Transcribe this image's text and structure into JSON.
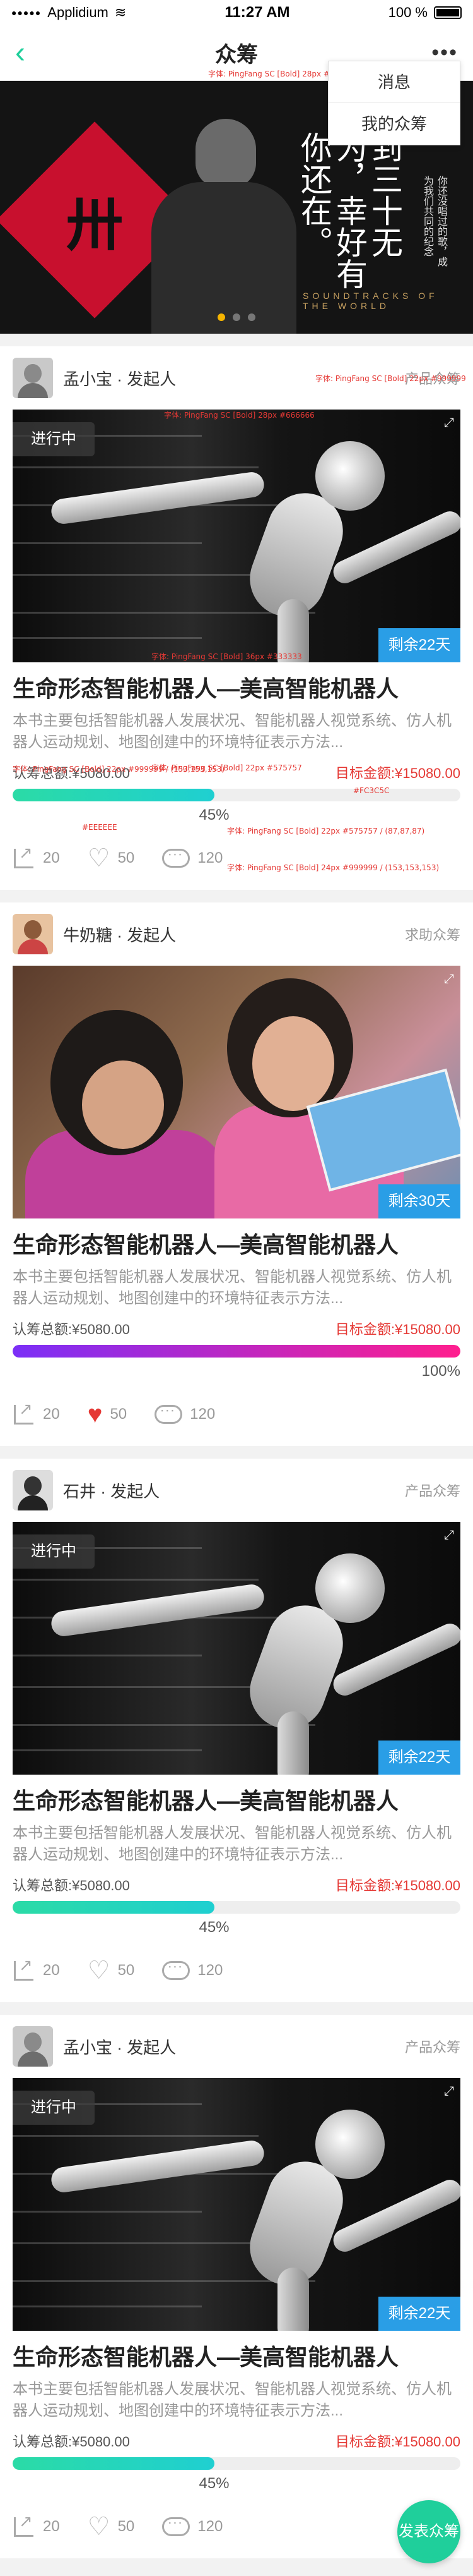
{
  "status_bar": {
    "carrier": "Applidium",
    "time": "11:27 AM",
    "battery": "100 %"
  },
  "nav": {
    "back_icon": "chevron-left-icon",
    "title": "众筹",
    "more_icon": "more-icon"
  },
  "dropdown": {
    "items": [
      "消息",
      "我的众筹"
    ]
  },
  "banner": {
    "slogan": "到三十无为，幸好有你还在。",
    "small_text": "你还没唱过的歌，成为我们共同的纪念",
    "caption": "SOUNDTRACKS OF THE WORLD",
    "pages": 3,
    "active_page": 0
  },
  "colors": {
    "accent": "#1fcf9b",
    "target_red": "#e53935",
    "days_blue": "#2a9ee6"
  },
  "cards": [
    {
      "user": "孟小宝 · 发起人",
      "category": "产品众筹",
      "cover": "robot",
      "progress_tag": "进行中",
      "days_left": "剩余22天",
      "title": "生命形态智能机器人—美高智能机器人",
      "desc": "本书主要包括智能机器人发展状况、智能机器人视觉系统、仿人机器人运动规划、地图创建中的环境特征表示方法...",
      "raised": "认筹总额:¥5080.00",
      "target": "目标金额:¥15080.00",
      "percent": 45,
      "percent_label": "45%",
      "bar": "teal",
      "shares": "20",
      "likes": "50",
      "liked": false,
      "comments": "120"
    },
    {
      "user": "牛奶糖 · 发起人",
      "category": "求助众筹",
      "cover": "kids",
      "progress_tag": "",
      "days_left": "剩余30天",
      "title": "生命形态智能机器人—美高智能机器人",
      "desc": "本书主要包括智能机器人发展状况、智能机器人视觉系统、仿人机器人运动规划、地图创建中的环境特征表示方法...",
      "raised": "认筹总额:¥5080.00",
      "target": "目标金额:¥15080.00",
      "percent": 100,
      "percent_label": "100%",
      "bar": "pink",
      "shares": "20",
      "likes": "50",
      "liked": true,
      "comments": "120"
    },
    {
      "user": "石井 · 发起人",
      "category": "产品众筹",
      "cover": "robot",
      "progress_tag": "进行中",
      "days_left": "剩余22天",
      "title": "生命形态智能机器人—美高智能机器人",
      "desc": "本书主要包括智能机器人发展状况、智能机器人视觉系统、仿人机器人运动规划、地图创建中的环境特征表示方法...",
      "raised": "认筹总额:¥5080.00",
      "target": "目标金额:¥15080.00",
      "percent": 45,
      "percent_label": "45%",
      "bar": "teal",
      "shares": "20",
      "likes": "50",
      "liked": false,
      "comments": "120"
    },
    {
      "user": "孟小宝 · 发起人",
      "category": "产品众筹",
      "cover": "robot",
      "progress_tag": "进行中",
      "days_left": "剩余22天",
      "title": "生命形态智能机器人—美高智能机器人",
      "desc": "本书主要包括智能机器人发展状况、智能机器人视觉系统、仿人机器人运动规划、地图创建中的环境特征表示方法...",
      "raised": "认筹总额:¥5080.00",
      "target": "目标金额:¥15080.00",
      "percent": 45,
      "percent_label": "45%",
      "bar": "teal",
      "shares": "20",
      "likes": "50",
      "liked": false,
      "comments": "120"
    }
  ],
  "fab": {
    "label": "发表众筹"
  },
  "annotations": [
    "字体: PingFang SC [Bold] 28px #666666",
    "字体: PingFang SC [Bold] 28px #666666",
    "字体: PingFang SC [Bold] 22px #999999",
    "字体: PingFang SC [Bold] 36px #333333",
    "字体: PingFang SC [Bold] 22px #999999 / (153,153,153)",
    "字体: PingFang SC [Bold] 22px #575757",
    "字体: PingFang SC [Bold] 22px #575757 / (87,87,87)",
    "字体: PingFang SC [Bold] 24px #999999 / (153,153,153)",
    "#FC3C5C",
    "#EEEEEE",
    "20px",
    "40px",
    "60px",
    "100px",
    "14px"
  ]
}
